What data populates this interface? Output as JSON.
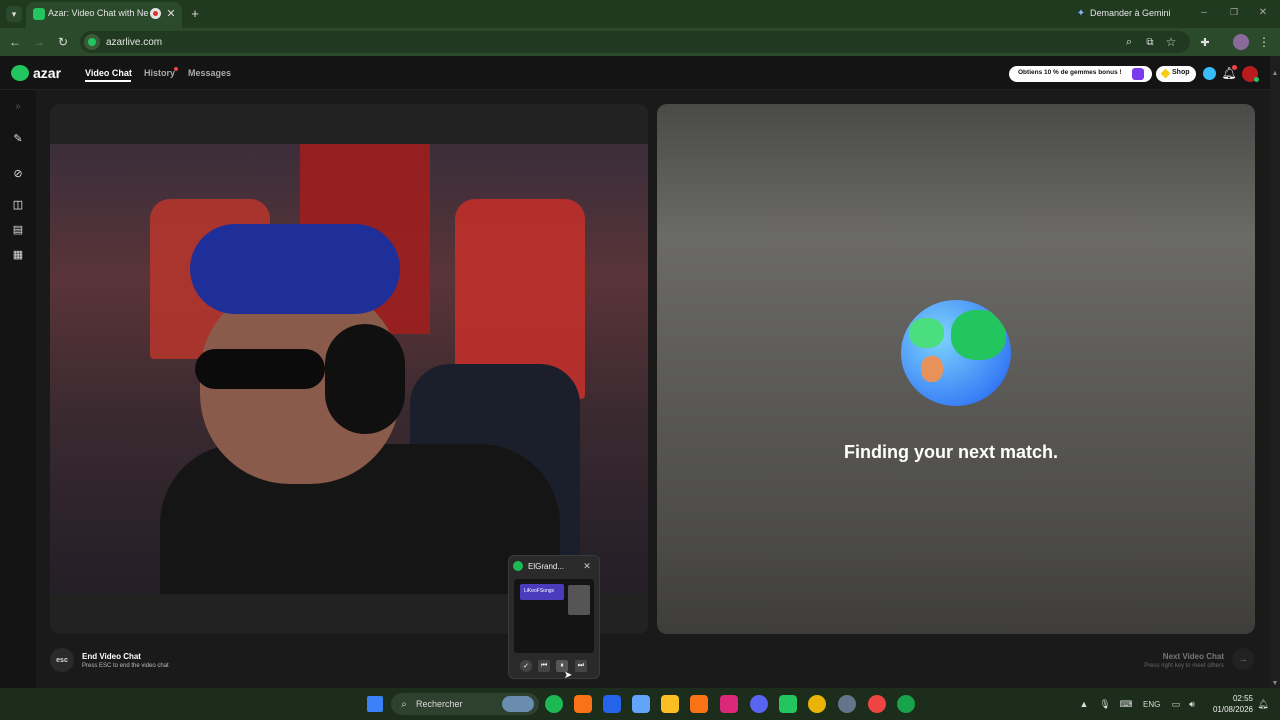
{
  "browser": {
    "tab_title": "Azar: Video Chat with New",
    "url": "azarlive.com",
    "gemini_label": "Demander à Gemini"
  },
  "app": {
    "logo_text": "azar",
    "nav": [
      {
        "label": "Video Chat",
        "active": true
      },
      {
        "label": "History",
        "active": false
      },
      {
        "label": "Messages",
        "active": false
      }
    ],
    "promo_label": "Obtiens 10 % de gemmes bonus !",
    "shop_label": "Shop"
  },
  "match": {
    "status_text": "Finding your next match."
  },
  "footer": {
    "esc_key": "esc",
    "end_title": "End Video Chat",
    "end_hint": "Press ESC to end the video chat",
    "next_title": "Next Video Chat",
    "next_hint": "Press right key to meet others"
  },
  "media_popup": {
    "title": "ElGrand...",
    "thumb_label": "LiKeoFSongs"
  },
  "taskbar": {
    "search_placeholder": "Rechercher",
    "language": "ENG",
    "time": "02:55",
    "date": "01/08/2026"
  },
  "colors": {
    "accent_green": "#22c55e",
    "tab_bar": "#1f3a1f",
    "toolbar": "#2b4a2b",
    "app_bg": "#141414"
  }
}
